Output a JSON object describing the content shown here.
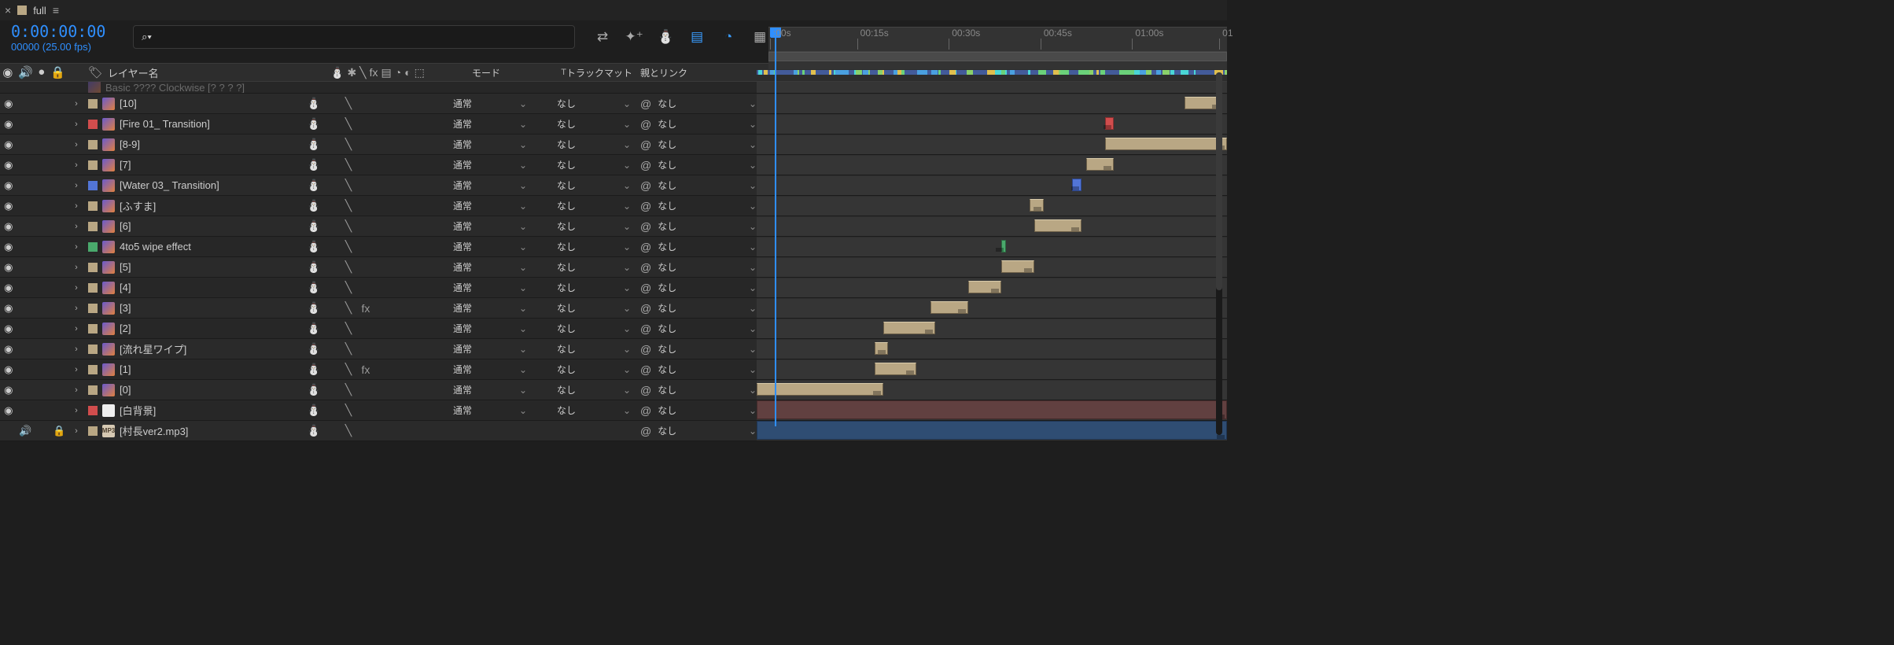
{
  "tab": {
    "title": "full"
  },
  "time": {
    "tc": "0:00:00:00",
    "frames": "00000 (25.00 fps)"
  },
  "hdr": {
    "layer_name": "レイヤー名",
    "mode": "モード",
    "t": "T",
    "matte": "トラックマット",
    "parent": "親とリンク"
  },
  "dropdowns": {
    "mode": "通常",
    "matte": "なし",
    "parent": "なし"
  },
  "ruler_ticks": [
    {
      "pct": 1,
      "label": ":00s"
    },
    {
      "pct": 20,
      "label": "00:15s"
    },
    {
      "pct": 40,
      "label": "00:30s"
    },
    {
      "pct": 60,
      "label": "00:45s"
    },
    {
      "pct": 80,
      "label": "01:00s"
    },
    {
      "pct": 99,
      "label": "01"
    }
  ],
  "truncated": {
    "name": "Basic ???? Clockwise [? ? ? ?]"
  },
  "layers": [
    {
      "name": "[10]",
      "label_color": "#b9a784",
      "type": "comp",
      "fx": false,
      "mode": true,
      "matte": true,
      "bar": {
        "start_pct": 91,
        "width_pct": 8,
        "color": "tan"
      }
    },
    {
      "name": "[Fire 01_ Transition]",
      "label_color": "#d14d4d",
      "type": "comp",
      "fx": false,
      "mode": true,
      "matte": true,
      "bar": {
        "start_pct": 74,
        "width_pct": 2,
        "color": "red"
      }
    },
    {
      "name": "[8-9]",
      "label_color": "#b9a784",
      "type": "comp",
      "fx": false,
      "mode": true,
      "matte": true,
      "bar": {
        "start_pct": 74,
        "width_pct": 26,
        "color": "tan"
      }
    },
    {
      "name": "[7]",
      "label_color": "#b9a784",
      "type": "comp",
      "fx": false,
      "mode": true,
      "matte": true,
      "bar": {
        "start_pct": 70,
        "width_pct": 6,
        "color": "tan"
      }
    },
    {
      "name": "[Water 03_ Transition]",
      "label_color": "#5275d6",
      "type": "comp",
      "fx": false,
      "mode": true,
      "matte": true,
      "bar": {
        "start_pct": 67,
        "width_pct": 2,
        "color": "blue"
      }
    },
    {
      "name": "[ふすま]",
      "label_color": "#b9a784",
      "type": "comp",
      "fx": false,
      "mode": true,
      "matte": true,
      "bar": {
        "start_pct": 58,
        "width_pct": 3,
        "color": "tan"
      }
    },
    {
      "name": "[6]",
      "label_color": "#b9a784",
      "type": "comp",
      "fx": false,
      "mode": true,
      "matte": true,
      "bar": {
        "start_pct": 59,
        "width_pct": 10,
        "color": "tan"
      }
    },
    {
      "name": "4to5 wipe effect",
      "label_color": "#4aa96c",
      "type": "comp",
      "fx": false,
      "mode": true,
      "matte": true,
      "bar": {
        "start_pct": 52,
        "width_pct": 1,
        "color": "green"
      }
    },
    {
      "name": "[5]",
      "label_color": "#b9a784",
      "type": "comp",
      "fx": false,
      "mode": true,
      "matte": true,
      "bar": {
        "start_pct": 52,
        "width_pct": 7,
        "color": "tan"
      }
    },
    {
      "name": "[4]",
      "label_color": "#b9a784",
      "type": "comp",
      "fx": false,
      "mode": true,
      "matte": true,
      "bar": {
        "start_pct": 45,
        "width_pct": 7,
        "color": "tan"
      }
    },
    {
      "name": "[3]",
      "label_color": "#b9a784",
      "type": "comp",
      "fx": true,
      "mode": true,
      "matte": true,
      "bar": {
        "start_pct": 37,
        "width_pct": 8,
        "color": "tan"
      }
    },
    {
      "name": "[2]",
      "label_color": "#b9a784",
      "type": "comp",
      "fx": false,
      "mode": true,
      "matte": true,
      "bar": {
        "start_pct": 27,
        "width_pct": 11,
        "color": "tan"
      }
    },
    {
      "name": "[流れ星ワイプ]",
      "label_color": "#b9a784",
      "type": "comp",
      "fx": false,
      "mode": true,
      "matte": true,
      "bar": {
        "start_pct": 25,
        "width_pct": 3,
        "color": "tan"
      }
    },
    {
      "name": "[1]",
      "label_color": "#b9a784",
      "type": "comp",
      "fx": true,
      "mode": true,
      "matte": true,
      "bar": {
        "start_pct": 25,
        "width_pct": 9,
        "color": "tan"
      }
    },
    {
      "name": "[0]",
      "label_color": "#b9a784",
      "type": "comp",
      "fx": false,
      "mode": true,
      "matte": true,
      "bar": {
        "start_pct": 0,
        "width_pct": 27,
        "color": "tan"
      }
    },
    {
      "name": "[白背景]",
      "label_color": "#d14d4d",
      "type": "solid",
      "fx": false,
      "mode": true,
      "matte": true,
      "bar": {
        "start_pct": 0,
        "width_pct": 100,
        "color": "fullmaroon"
      }
    },
    {
      "name": "[村長ver2.mp3]",
      "label_color": "#b9a784",
      "type": "audio",
      "fx": false,
      "mode": false,
      "matte": false,
      "locked": true,
      "audio_only": true,
      "bar": {
        "start_pct": 0,
        "width_pct": 100,
        "color": "fullblue"
      }
    }
  ]
}
